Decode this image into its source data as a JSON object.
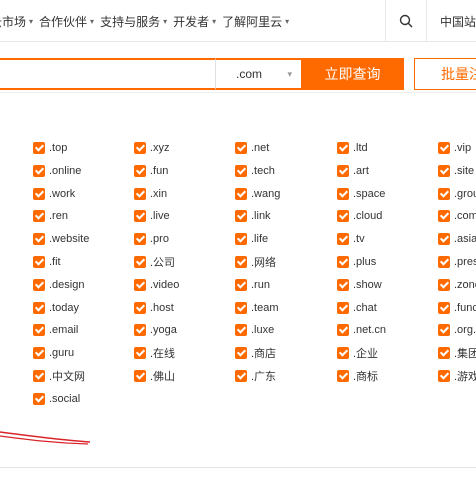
{
  "nav": {
    "items": [
      "云市场",
      "合作伙伴",
      "支持与服务",
      "开发者",
      "了解阿里云"
    ],
    "region": "中国站"
  },
  "search": {
    "tld_selected": ".com",
    "query_label": "立即查询",
    "bulk_label": "批量注"
  },
  "tld_columns": [
    [
      ".top",
      ".online",
      ".work",
      ".ren",
      ".website",
      ".fit",
      ".design",
      ".today",
      ".email",
      ".guru",
      ".中文网",
      ".social"
    ],
    [
      ".xyz",
      ".fun",
      ".xin",
      ".live",
      ".pro",
      ".公司",
      ".video",
      ".host",
      ".yoga",
      ".在线",
      ".佛山"
    ],
    [
      ".net",
      ".tech",
      ".wang",
      ".link",
      ".life",
      ".网络",
      ".run",
      ".team",
      ".luxe",
      ".商店",
      ".广东"
    ],
    [
      ".ltd",
      ".art",
      ".space",
      ".cloud",
      ".tv",
      ".plus",
      ".show",
      ".chat",
      ".net.cn",
      ".企业",
      ".商标"
    ],
    [
      ".vip",
      ".site",
      ".grou",
      ".com",
      ".asia",
      ".pres",
      ".zone",
      ".func",
      ".org.",
      ".集团",
      ".游戏"
    ]
  ],
  "colors": {
    "accent": "#ff6a00",
    "annotation": "#d9252a"
  },
  "icons": {
    "search": "search-icon",
    "checkbox": "checkbox-checked-icon"
  }
}
